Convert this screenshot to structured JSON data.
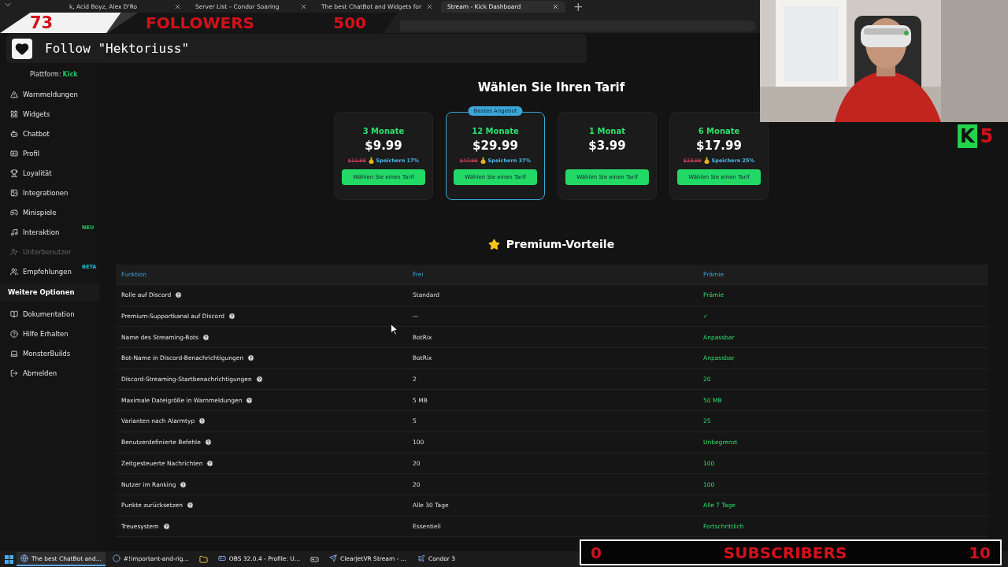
{
  "browser": {
    "tabs": [
      {
        "title": "k, Acid Boyz, Alex D'Ro",
        "selected": false
      },
      {
        "title": "Server List – Condor Soaring",
        "selected": false
      },
      {
        "title": "The best ChatBot and Widgets for",
        "selected": false
      },
      {
        "title": "Stream - Kick Dashboard",
        "selected": true
      }
    ],
    "new_tab": "+"
  },
  "sidebar": {
    "platform_label": "Plattform:",
    "platform": "Kick",
    "items": [
      {
        "label": "Warnmeldungen",
        "disabled": false
      },
      {
        "label": "Widgets",
        "disabled": false
      },
      {
        "label": "Chatbot",
        "disabled": false
      },
      {
        "label": "Profil",
        "disabled": false
      },
      {
        "label": "Loyalität",
        "disabled": false
      },
      {
        "label": "Integrationen",
        "disabled": false
      },
      {
        "label": "Minispiele",
        "disabled": false
      },
      {
        "label": "Interaktion",
        "disabled": false,
        "badge": "NEU",
        "color": "#22c55e"
      },
      {
        "label": "Unterbenutzer",
        "disabled": true
      },
      {
        "label": "Empfehlungen",
        "disabled": false,
        "badge": "BETA",
        "color": "#22b8cf"
      }
    ],
    "section": "Weitere Optionen",
    "more_items": [
      {
        "label": "Dokumentation"
      },
      {
        "label": "Hilfe Erhalten"
      },
      {
        "label": "MonsterBuilds"
      },
      {
        "label": "Abmelden"
      }
    ]
  },
  "pricing": {
    "title": "Wählen Sie Ihren Tarif",
    "plans": [
      {
        "duration": "3 Monate",
        "price": "$9.99",
        "old_price": "$11.99",
        "savings": "Speichern 17%",
        "button": "Wählen Sie einen Tarif",
        "selected": false
      },
      {
        "duration": "12 Monate",
        "price": "$29.99",
        "old_price": "$47.99",
        "savings": "Speichern 37%",
        "button": "Wählen Sie einen Tarif",
        "selected": true,
        "badge": "Bestes Angebot"
      },
      {
        "duration": "1 Monat",
        "price": "$3.99",
        "button": "Wählen Sie einen Tarif",
        "selected": false
      },
      {
        "duration": "6 Monate",
        "price": "$17.99",
        "old_price": "$23.99",
        "savings": "Speichern 25%",
        "button": "Wählen Sie einen Tarif",
        "selected": false
      }
    ]
  },
  "benefits": {
    "title": "Premium-Vorteile",
    "columns": [
      "Funktion",
      "Frei",
      "Prämie"
    ],
    "rows": [
      {
        "feature": "Rolle auf Discord",
        "free": "Standard",
        "premium": "Prämie"
      },
      {
        "feature": "Premium-Supportkanal auf Discord",
        "free": "—",
        "premium": "✓"
      },
      {
        "feature": "Name des Streaming-Bots",
        "free": "BotRix",
        "premium": "Anpassbar"
      },
      {
        "feature": "Bot-Name in Discord-Benachrichtigungen",
        "free": "BotRix",
        "premium": "Anpassbar"
      },
      {
        "feature": "Discord-Streaming-Startbenachrichtigungen",
        "free": "2",
        "premium": "20"
      },
      {
        "feature": "Maximale Dateigröße in Warnmeldungen",
        "free": "5 MB",
        "premium": "50 MB"
      },
      {
        "feature": "Varianten nach Alarmtyp",
        "free": "5",
        "premium": "25"
      },
      {
        "feature": "Benutzerdefinierte Befehle",
        "free": "100",
        "premium": "Unbegrenzt"
      },
      {
        "feature": "Zeitgesteuerte Nachrichten",
        "free": "20",
        "premium": "100"
      },
      {
        "feature": "Nutzer im Ranking",
        "free": "20",
        "premium": "100"
      },
      {
        "feature": "Punkte zurücksetzen",
        "free": "Alle 30 Tage",
        "premium": "Alle 7 Tage"
      },
      {
        "feature": "Treuesystem",
        "free": "Essentiell",
        "premium": "Fortschrittlich"
      }
    ]
  },
  "taskbar": {
    "items": [
      {
        "label": "The best ChatBot and...",
        "selected": true
      },
      {
        "label": "#!important-and-rig...",
        "selected": false
      },
      {
        "label": "OBS 32.0.4 - Profile: U...",
        "selected": false
      },
      {
        "label": "ClearJetVR Stream - ...",
        "selected": false
      },
      {
        "label": "Condor 3",
        "selected": false
      }
    ]
  },
  "stream_overlay": {
    "followers_goal": {
      "count": "73",
      "label": "FOLLOWERS",
      "goal": "500"
    },
    "alert": {
      "text": "Follow \"Hektoriuss\""
    },
    "kick_badge": {
      "letter": "K",
      "count": "5"
    },
    "subscribers_goal": {
      "count": "0",
      "label": "SUBSCRIBERS",
      "goal": "10"
    }
  }
}
